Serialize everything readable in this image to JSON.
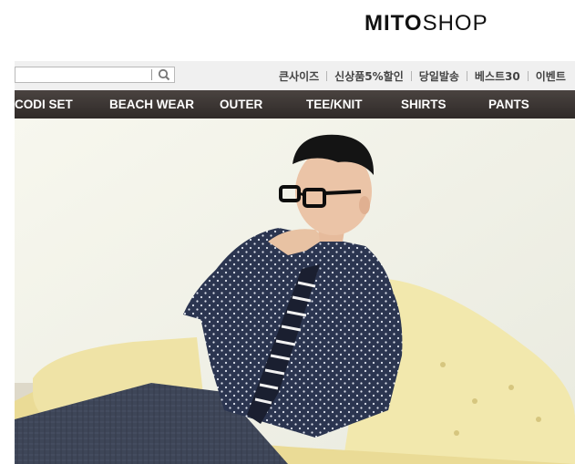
{
  "header": {
    "logo_bold": "MITO",
    "logo_regular": "SHOP"
  },
  "search": {
    "value": "",
    "placeholder": ""
  },
  "util_links": [
    "큰사이즈",
    "신상품5%할인",
    "당일발송",
    "베스트30",
    "이벤트"
  ],
  "nav": [
    "CODI SET",
    "BEACH WEAR",
    "OUTER",
    "TEE/KNIT",
    "SHIRTS",
    "PANTS"
  ],
  "colors": {
    "nav_bg": "#3c3533",
    "util_bg": "#f0f0f0",
    "shirt": "#2b3550",
    "sofa": "#f1e7a8",
    "wall": "#f3f3ea"
  },
  "hero": {
    "icon": "model-photo"
  }
}
